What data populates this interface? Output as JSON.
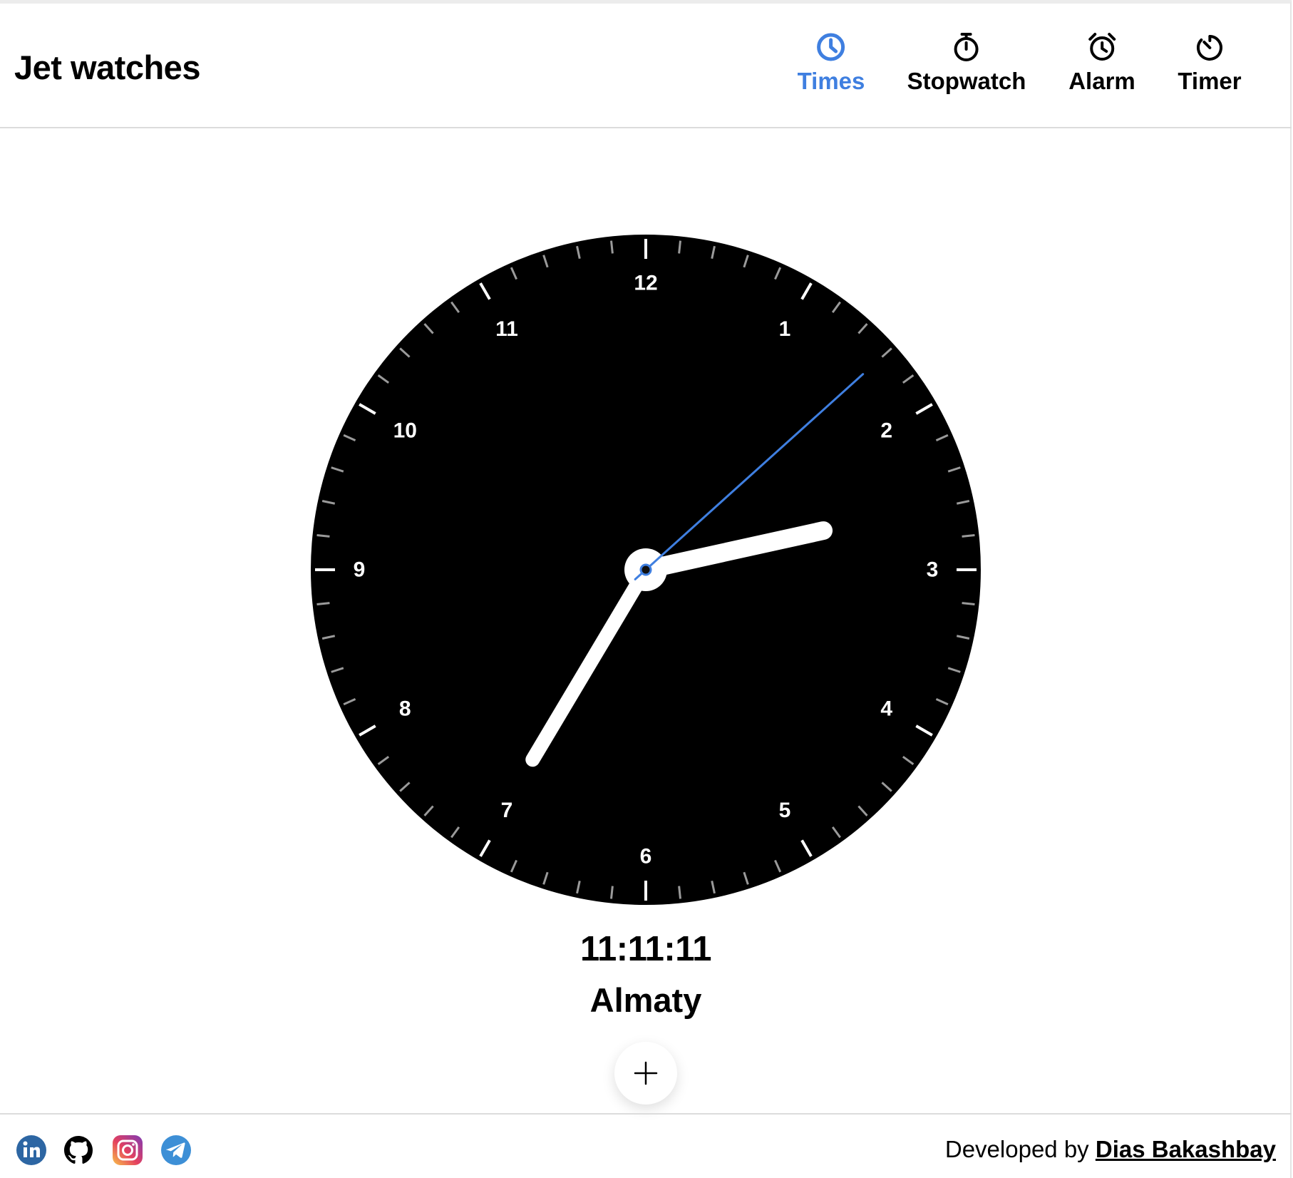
{
  "app": {
    "title": "Jet watches"
  },
  "nav": {
    "items": [
      {
        "label": "Times",
        "icon": "clock-icon",
        "active": true
      },
      {
        "label": "Stopwatch",
        "icon": "stopwatch-icon",
        "active": false
      },
      {
        "label": "Alarm",
        "icon": "alarm-icon",
        "active": false
      },
      {
        "label": "Timer",
        "icon": "timer-icon",
        "active": false
      }
    ],
    "active_color": "#3f7fe0"
  },
  "clock": {
    "numerals": [
      "12",
      "1",
      "2",
      "3",
      "4",
      "5",
      "6",
      "7",
      "8",
      "9",
      "10",
      "11"
    ],
    "time": {
      "hours": 2,
      "minutes": 35,
      "seconds": 8
    },
    "face_color": "#000000",
    "hand_color": "#ffffff",
    "second_hand_color": "#3f7fe0"
  },
  "main": {
    "time_display": "11:11:11",
    "city": "Almaty",
    "add_icon": "plus-icon"
  },
  "footer": {
    "socials": [
      "linkedin-icon",
      "github-icon",
      "instagram-icon",
      "telegram-icon"
    ],
    "credit_prefix": "Developed by",
    "credit_name": "Dias Bakashbay"
  }
}
